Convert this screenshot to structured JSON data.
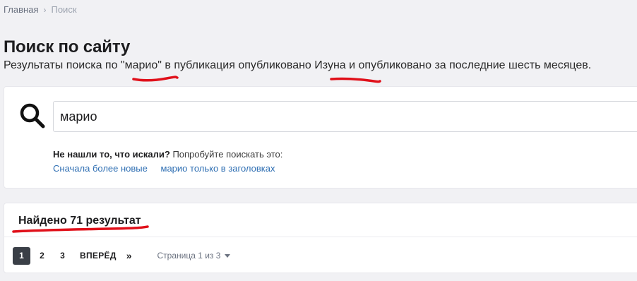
{
  "breadcrumb": {
    "home": "Главная",
    "separator": "›",
    "current": "Поиск"
  },
  "page": {
    "title": "Поиск по сайту",
    "summary": {
      "prefix": "Результаты поиска по ",
      "query": "\"марио\"",
      "middle": " в публикация опубликовано ",
      "author": "Изуна",
      "suffix": " и опубликовано за последние шесть месяцев."
    }
  },
  "search": {
    "value": "марио",
    "not_found_bold": "Не нашли то, что искали?",
    "not_found_rest": " Попробуйте поискать это:",
    "suggestions": [
      "Сначала более новые",
      "марио только в заголовках"
    ]
  },
  "results": {
    "header": "Найдено 71 результат",
    "pagination": {
      "pages": [
        "1",
        "2",
        "3"
      ],
      "active": "1",
      "next": "ВПЕРЁД",
      "last": "»",
      "info": "Страница 1 из 3"
    }
  },
  "colors": {
    "annotation_red": "#e0101a",
    "link": "#2f6fb3",
    "active_page": "#3a3f47"
  }
}
